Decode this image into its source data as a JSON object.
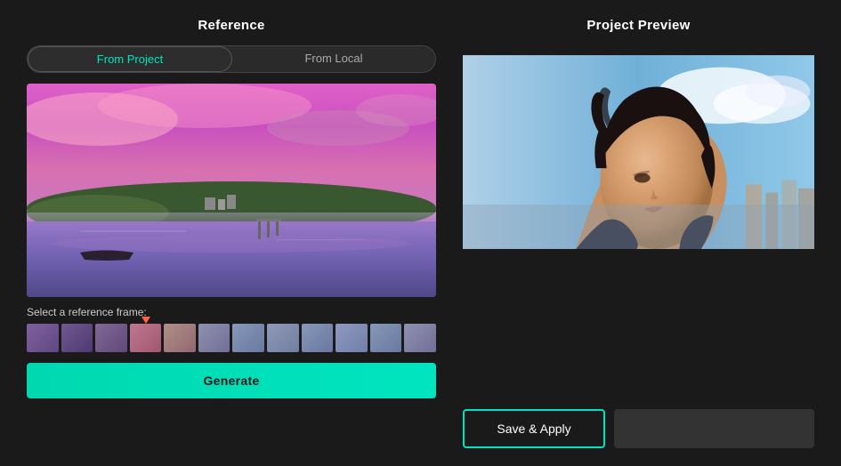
{
  "left_panel": {
    "title": "Reference",
    "tab_from_project": "From Project",
    "tab_from_local": "From Local",
    "active_tab": "from_project",
    "select_frame_label": "Select a reference frame:",
    "generate_label": "Generate"
  },
  "right_panel": {
    "title": "Project Preview",
    "save_apply_label": "Save & Apply"
  },
  "filmstrip": {
    "thumb_count": 12,
    "marker_index": 4
  }
}
